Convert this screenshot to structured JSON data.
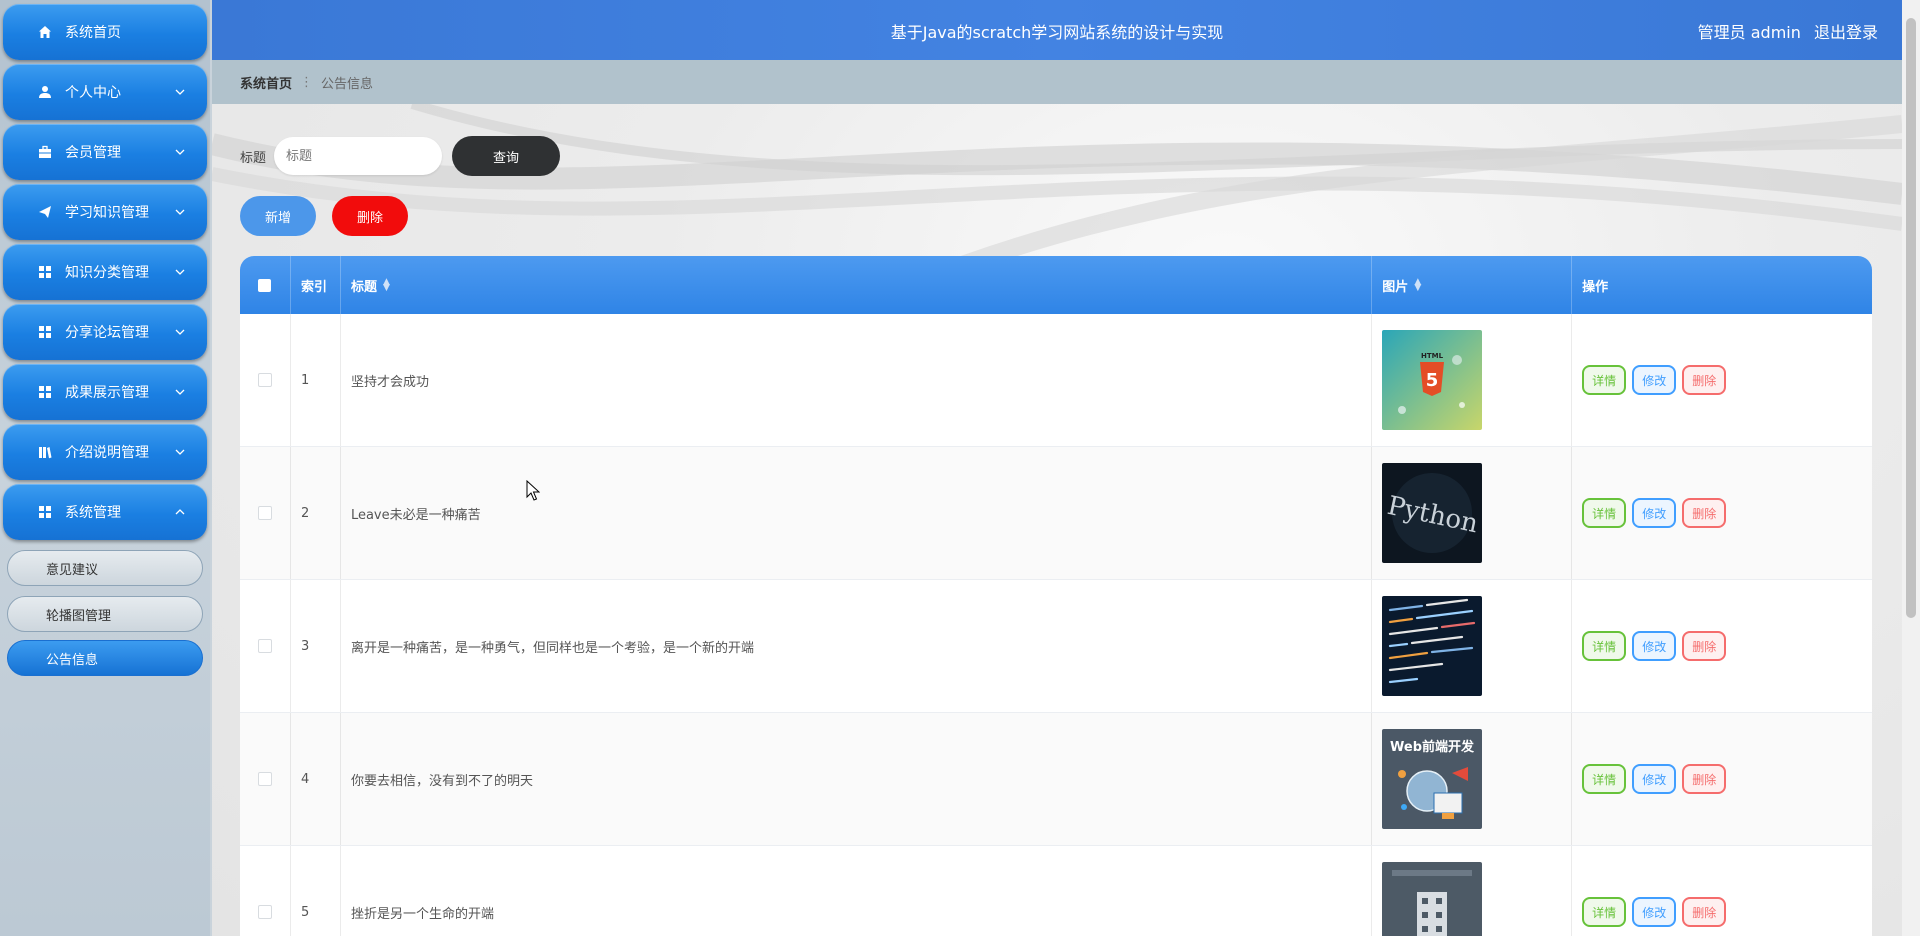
{
  "app": {
    "title": "基于Java的scratch学习网站系统的设计与实现"
  },
  "header": {
    "user_label": "管理员 admin",
    "logout_label": "退出登录"
  },
  "colors": {
    "accent": "#2f84e6",
    "danger": "#f20c0c",
    "dark_button": "#2f3133"
  },
  "sidebar": {
    "items": [
      {
        "label": "系统首页",
        "icon": "home-icon"
      },
      {
        "label": "个人中心",
        "icon": "user-icon"
      },
      {
        "label": "会员管理",
        "icon": "briefcase-icon"
      },
      {
        "label": "学习知识管理",
        "icon": "send-icon"
      },
      {
        "label": "知识分类管理",
        "icon": "grid-icon"
      },
      {
        "label": "分享论坛管理",
        "icon": "grid-icon"
      },
      {
        "label": "成果展示管理",
        "icon": "grid-icon"
      },
      {
        "label": "介绍说明管理",
        "icon": "library-icon"
      },
      {
        "label": "系统管理",
        "icon": "grid-icon"
      }
    ],
    "sub_items": [
      {
        "label": "意见建议"
      },
      {
        "label": "轮播图管理"
      },
      {
        "label": "公告信息"
      }
    ]
  },
  "breadcrumb": {
    "home": "系统首页",
    "current": "公告信息"
  },
  "search": {
    "label": "标题",
    "placeholder": "标题",
    "button": "查询"
  },
  "actions": {
    "add": "新增",
    "delete": "删除"
  },
  "table": {
    "headers": {
      "index": "索引",
      "title": "标题",
      "image": "图片",
      "ops": "操作"
    },
    "op_labels": {
      "detail": "详情",
      "edit": "修改",
      "delete": "删除"
    },
    "rows": [
      {
        "index": "1",
        "title": "坚持才会成功",
        "image": "html5-thumbnail"
      },
      {
        "index": "2",
        "title": "Leave未必是一种痛苦",
        "image": "python-thumbnail"
      },
      {
        "index": "3",
        "title": "离开是一种痛苦，是一种勇气，但同样也是一个考验，是一个新的开端",
        "image": "code-thumbnail"
      },
      {
        "index": "4",
        "title": "你要去相信，没有到不了的明天",
        "image": "web-frontend-thumbnail"
      },
      {
        "index": "5",
        "title": "挫折是另一个生命的开端",
        "image": "building-thumbnail"
      }
    ]
  },
  "thumbnail_text": {
    "html5": "HTML",
    "python": "Python",
    "web": "Web前端开发"
  }
}
